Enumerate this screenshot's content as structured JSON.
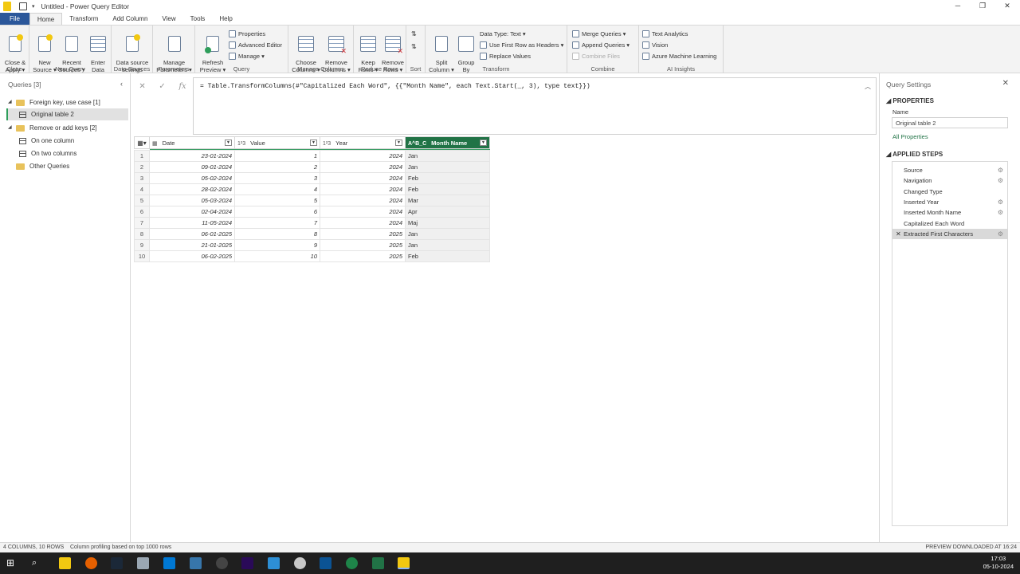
{
  "window": {
    "title": "Untitled - Power Query Editor",
    "minimize": "─",
    "maximize": "❐",
    "close": "✕"
  },
  "tabs": [
    "File",
    "Home",
    "Transform",
    "Add Column",
    "View",
    "Tools",
    "Help"
  ],
  "ribbon": {
    "close_apply": "Close &\nApply ▾",
    "new_source": "New\nSource ▾",
    "recent_sources": "Recent\nSources ▾",
    "enter_data": "Enter\nData",
    "data_source_settings": "Data source\nsettings",
    "manage_parameters": "Manage\nParameters ▾",
    "refresh_preview": "Refresh\nPreview ▾",
    "properties": "Properties",
    "advanced_editor": "Advanced Editor",
    "manage": "Manage ▾",
    "choose_columns": "Choose\nColumns ▾",
    "remove_columns": "Remove\nColumns ▾",
    "keep_rows": "Keep\nRows ▾",
    "remove_rows": "Remove\nRows ▾",
    "split_column": "Split\nColumn ▾",
    "group_by": "Group\nBy",
    "data_type": "Data Type: Text ▾",
    "use_first_row": "Use First Row as Headers ▾",
    "replace_values": "Replace Values",
    "merge_queries": "Merge Queries ▾",
    "append_queries": "Append Queries ▾",
    "combine_files": "Combine Files",
    "text_analytics": "Text Analytics",
    "vision": "Vision",
    "azure_ml": "Azure Machine Learning",
    "groups": {
      "close": "Close",
      "new_query": "New Query",
      "data_sources": "Data Sources",
      "parameters": "Parameters",
      "query": "Query",
      "manage_columns": "Manage Columns",
      "reduce_rows": "Reduce Rows",
      "sort": "Sort",
      "transform": "Transform",
      "combine": "Combine",
      "ai_insights": "AI Insights"
    }
  },
  "queries_pane": {
    "header": "Queries [3]",
    "items": [
      {
        "label": "Foreign key, use case [1]",
        "type": "folder"
      },
      {
        "label": "Original table 2",
        "type": "table",
        "selected": true
      },
      {
        "label": "Remove or add keys [2]",
        "type": "folder"
      },
      {
        "label": "On one column",
        "type": "table"
      },
      {
        "label": "On two columns",
        "type": "table"
      },
      {
        "label": "Other Queries",
        "type": "folder"
      }
    ]
  },
  "formula": {
    "cancel": "✕",
    "confirm": "✓",
    "fx": "fx",
    "text": "= Table.TransformColumns(#\"Capitalized Each Word\", {{\"Month Name\", each Text.Start(_, 3), type text}})"
  },
  "grid": {
    "columns": [
      {
        "type_icon": "▦",
        "name": "Date"
      },
      {
        "type_icon": "1²3",
        "name": "Value"
      },
      {
        "type_icon": "1²3",
        "name": "Year"
      },
      {
        "type_icon": "A^B_C",
        "name": "Month Name"
      }
    ],
    "rows": [
      [
        "1",
        "23-01-2024",
        "1",
        "2024",
        "Jan"
      ],
      [
        "2",
        "09-01-2024",
        "2",
        "2024",
        "Jan"
      ],
      [
        "3",
        "05-02-2024",
        "3",
        "2024",
        "Feb"
      ],
      [
        "4",
        "28-02-2024",
        "4",
        "2024",
        "Feb"
      ],
      [
        "5",
        "05-03-2024",
        "5",
        "2024",
        "Mar"
      ],
      [
        "6",
        "02-04-2024",
        "6",
        "2024",
        "Apr"
      ],
      [
        "7",
        "11-05-2024",
        "7",
        "2024",
        "Maj"
      ],
      [
        "8",
        "06-01-2025",
        "8",
        "2025",
        "Jan"
      ],
      [
        "9",
        "21-01-2025",
        "9",
        "2025",
        "Jan"
      ],
      [
        "10",
        "06-02-2025",
        "10",
        "2025",
        "Feb"
      ]
    ]
  },
  "settings": {
    "title": "Query Settings",
    "properties_header": "PROPERTIES",
    "name_label": "Name",
    "name_value": "Original table 2",
    "all_properties": "All Properties",
    "applied_steps_header": "APPLIED STEPS",
    "steps": [
      {
        "label": "Source",
        "gear": true
      },
      {
        "label": "Navigation",
        "gear": true
      },
      {
        "label": "Changed Type",
        "gear": false
      },
      {
        "label": "Inserted Year",
        "gear": true
      },
      {
        "label": "Inserted Month Name",
        "gear": true
      },
      {
        "label": "Capitalized Each Word",
        "gear": false
      },
      {
        "label": "Extracted First Characters",
        "gear": true,
        "selected": true
      }
    ]
  },
  "status": {
    "left": "4 COLUMNS, 10 ROWS",
    "profiling": "Column profiling based on top 1000 rows",
    "right": "PREVIEW DOWNLOADED AT 16:24"
  },
  "taskbar": {
    "time": "17:03",
    "date": "05-10-2024"
  },
  "colors": {
    "accent_green": "#217346",
    "file_tab": "#2b579a",
    "taskbar": "#1f1f1f"
  }
}
